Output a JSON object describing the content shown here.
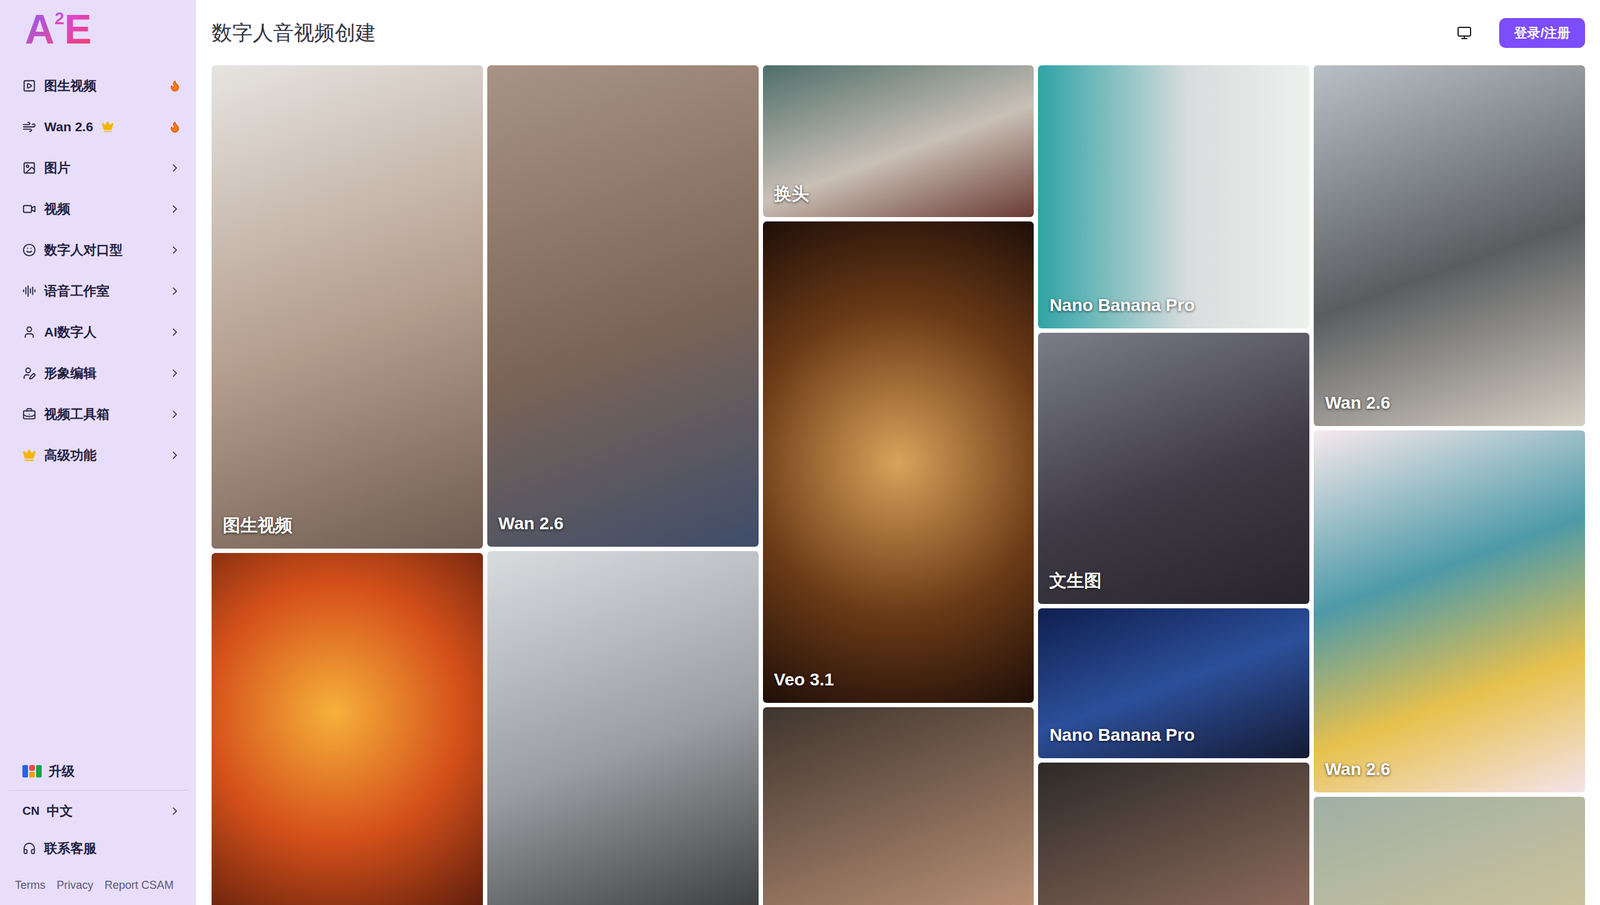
{
  "logo": {
    "letter1": "A",
    "superscript": "2",
    "letter2": "E"
  },
  "sidebar": {
    "items": [
      {
        "label": "图生视频",
        "hot": true,
        "premium": false,
        "expandable": false
      },
      {
        "label": "Wan 2.6",
        "hot": true,
        "premium": true,
        "expandable": false
      },
      {
        "label": "图片",
        "hot": false,
        "premium": false,
        "expandable": true
      },
      {
        "label": "视频",
        "hot": false,
        "premium": false,
        "expandable": true
      },
      {
        "label": "数字人对口型",
        "hot": false,
        "premium": false,
        "expandable": true
      },
      {
        "label": "语音工作室",
        "hot": false,
        "premium": false,
        "expandable": true
      },
      {
        "label": "AI数字人",
        "hot": false,
        "premium": false,
        "expandable": true
      },
      {
        "label": "形象编辑",
        "hot": false,
        "premium": false,
        "expandable": true
      },
      {
        "label": "视频工具箱",
        "hot": false,
        "premium": false,
        "expandable": true
      },
      {
        "label": "高级功能",
        "hot": false,
        "premium": false,
        "expandable": true
      }
    ],
    "upgrade": {
      "label": "升级"
    },
    "language": {
      "code": "CN",
      "label": "中文",
      "expandable": true
    },
    "support": {
      "label": "联系客服"
    },
    "footer_links": [
      "Terms",
      "Privacy",
      "Report CSAM"
    ]
  },
  "header": {
    "title": "数字人音视频创建",
    "login_button": "登录/注册"
  },
  "gallery": {
    "columns": [
      {
        "cards": [
          {
            "label": "图生视频"
          },
          {}
        ]
      },
      {
        "cards": [
          {
            "label": "Wan 2.6"
          },
          {}
        ]
      },
      {
        "cards": [
          {
            "label": "换头"
          },
          {
            "label": "Veo 3.1"
          },
          {}
        ]
      },
      {
        "cards": [
          {
            "label": "Nano Banana Pro"
          },
          {
            "label": "文生图"
          },
          {
            "label": "Nano Banana Pro"
          },
          {}
        ]
      },
      {
        "cards": [
          {
            "label": "Wan 2.6"
          },
          {
            "label": "Wan 2.6"
          },
          {}
        ]
      }
    ]
  }
}
